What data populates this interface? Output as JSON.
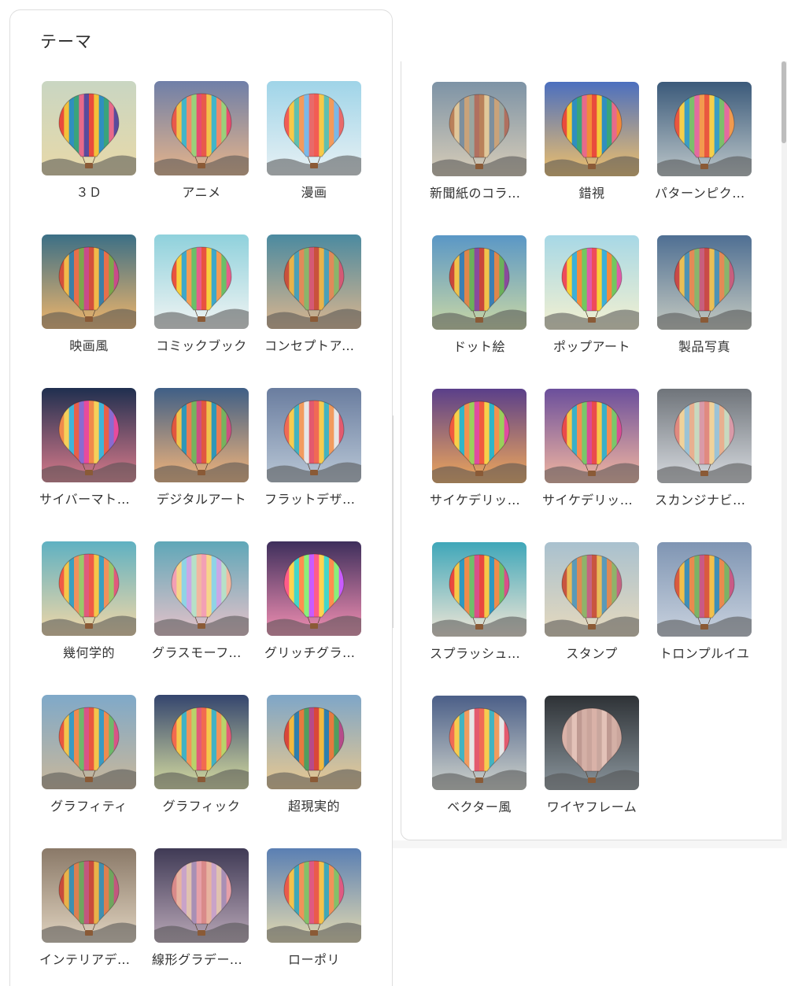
{
  "panel_title": "テーマ",
  "left_items": [
    {
      "label": "３Ｄ",
      "bg": [
        "#c9d6c2",
        "#e8d9a8"
      ],
      "stripes": [
        "#e94b3c",
        "#f3c13a",
        "#2f8fbf",
        "#3aa37b",
        "#e86a8a",
        "#5a4b9c"
      ]
    },
    {
      "label": "アニメ",
      "bg": [
        "#6f7fa8",
        "#e6b48a"
      ],
      "stripes": [
        "#e8594b",
        "#f2c14b",
        "#42b5c9",
        "#f08a6a",
        "#9ad07b",
        "#e84b6f"
      ]
    },
    {
      "label": "漫画",
      "bg": [
        "#9fd4e8",
        "#e8f1f4"
      ],
      "stripes": [
        "#f25c54",
        "#f7c948",
        "#5fbfb0",
        "#f49a5b",
        "#7ab8e8",
        "#e86a6a"
      ]
    },
    {
      "label": "映画風",
      "bg": [
        "#3b6f86",
        "#f0b56a"
      ],
      "stripes": [
        "#d4503b",
        "#f1b94a",
        "#3d7fa6",
        "#e86f4a",
        "#7da64b",
        "#c94b8a"
      ]
    },
    {
      "label": "コミックブック",
      "bg": [
        "#8fd1dc",
        "#f1f4f3"
      ],
      "stripes": [
        "#e9523f",
        "#f8cf3d",
        "#3da8c9",
        "#f39b55",
        "#6bbf68",
        "#e85c8a"
      ]
    },
    {
      "label": "コンセプトアート",
      "bg": [
        "#4b8aa0",
        "#d9b58e"
      ],
      "stripes": [
        "#c9513c",
        "#e7b34a",
        "#4aa0b8",
        "#e08a5a",
        "#8ab56b",
        "#d45a75"
      ]
    },
    {
      "label": "サイバーマトリックス",
      "bg": [
        "#1f2f4f",
        "#d97a8a"
      ],
      "stripes": [
        "#f08a4b",
        "#f5d05a",
        "#3fb5d9",
        "#e8604a",
        "#8a6bd0",
        "#e84b9c"
      ]
    },
    {
      "label": "デジタルアート",
      "bg": [
        "#3f5f86",
        "#f2b47a"
      ],
      "stripes": [
        "#e1573f",
        "#f0c24c",
        "#2f97b8",
        "#ea7c52",
        "#76b35e",
        "#cc4f82"
      ]
    },
    {
      "label": "フラットデザイン",
      "bg": [
        "#6a7d9f",
        "#b9c7d6"
      ],
      "stripes": [
        "#f06a55",
        "#f7cc4f",
        "#43b3c1",
        "#f29b5e",
        "#e6e6e6",
        "#e35a6e"
      ]
    },
    {
      "label": "幾何学的",
      "bg": [
        "#5fb1c2",
        "#f2d7a6"
      ],
      "stripes": [
        "#ef5a46",
        "#f5c64a",
        "#3a9fc0",
        "#f1905b",
        "#9ac86a",
        "#e05a7d"
      ]
    },
    {
      "label": "グラスモーフィズム",
      "bg": [
        "#5fa7b8",
        "#e6c2c9"
      ],
      "stripes": [
        "#f3a0b4",
        "#f6d58a",
        "#8fd3e6",
        "#c8a9e8",
        "#b6e0c8",
        "#f2b7a0"
      ]
    },
    {
      "label": "グリッチグラフィック",
      "bg": [
        "#3e2f5c",
        "#f28fb2"
      ],
      "stripes": [
        "#ff5c8a",
        "#ffd34f",
        "#44d6c9",
        "#ff8e4f",
        "#8af07a",
        "#c95cff"
      ]
    },
    {
      "label": "グラフィティ",
      "bg": [
        "#7fa9c9",
        "#c9b79a"
      ],
      "stripes": [
        "#e9573f",
        "#f3c44c",
        "#3a9ac2",
        "#ef8b4f",
        "#6fb86a",
        "#d95487"
      ]
    },
    {
      "label": "グラフィック",
      "bg": [
        "#34456e",
        "#d6dca0"
      ],
      "stripes": [
        "#f26a4f",
        "#f5c84b",
        "#41b2c4",
        "#f39459",
        "#b9d36a",
        "#e25b79"
      ]
    },
    {
      "label": "超現実的",
      "bg": [
        "#7ea6c8",
        "#e9c88f"
      ],
      "stripes": [
        "#d9473a",
        "#f1b93f",
        "#2e7fae",
        "#e57a3f",
        "#4f9e5f",
        "#b64b8a"
      ]
    },
    {
      "label": "インテリアデザイン",
      "bg": [
        "#8a7968",
        "#e0d3bf"
      ],
      "stripes": [
        "#c94b3b",
        "#e8b24a",
        "#3f8fb0",
        "#dd7f4f",
        "#6fa65e",
        "#c2577e"
      ]
    },
    {
      "label": "線形グラデーション",
      "bg": [
        "#3f3a55",
        "#b9a7b7"
      ],
      "stripes": [
        "#d98a8a",
        "#e7b3a0",
        "#c9a3c9",
        "#e0c2b0",
        "#a88fb5",
        "#e6a0a8"
      ]
    },
    {
      "label": "ローポリ",
      "bg": [
        "#5a7fb3",
        "#e2d9b0"
      ],
      "stripes": [
        "#ea5b4b",
        "#f4c24b",
        "#3fa8b9",
        "#f0925a",
        "#83c169",
        "#df5a82"
      ]
    }
  ],
  "right_items": [
    {
      "label": "新聞紙のコラージュ",
      "bg": [
        "#7d93a6",
        "#d8cdb8"
      ],
      "stripes": [
        "#b9805a",
        "#e0c79a",
        "#7d8f9e",
        "#c9a27a",
        "#9aa6a0",
        "#b07060"
      ]
    },
    {
      "label": "錯視",
      "bg": [
        "#4b6fbf",
        "#f0c06a"
      ],
      "stripes": [
        "#e94b3c",
        "#f5c93b",
        "#2f8fbf",
        "#3aa37b",
        "#e86a8a",
        "#f28a3a"
      ]
    },
    {
      "label": "パターンピクセル",
      "bg": [
        "#3b5a7a",
        "#bcc6c9"
      ],
      "stripes": [
        "#e9573f",
        "#f6cf4a",
        "#3b9ec4",
        "#7bbf6b",
        "#e36aa0",
        "#f29a4f"
      ]
    },
    {
      "label": "ドット絵",
      "bg": [
        "#5a97c6",
        "#c9d7a5"
      ],
      "stripes": [
        "#c9463b",
        "#f0c24b",
        "#3b7fb3",
        "#e0864a",
        "#6bb05a",
        "#8a4b9c"
      ]
    },
    {
      "label": "ポップアート",
      "bg": [
        "#a7d8e6",
        "#f3f0d0"
      ],
      "stripes": [
        "#ef4b5a",
        "#f7d23a",
        "#3bb0d9",
        "#f58a3f",
        "#73c75f",
        "#e05aa9"
      ]
    },
    {
      "label": "製品写真",
      "bg": [
        "#4f6f93",
        "#c4c9c0"
      ],
      "stripes": [
        "#c94a48",
        "#eabf55",
        "#4e93b5",
        "#e38a57",
        "#88b56d",
        "#c75f7e"
      ]
    },
    {
      "label": "サイケデリックアート",
      "bg": [
        "#5a3f8a",
        "#f0a85a"
      ],
      "stripes": [
        "#f05a3f",
        "#f7d04a",
        "#2fb5c9",
        "#f3904f",
        "#9ad05b",
        "#e04ba0"
      ]
    },
    {
      "label": "サイケデリックアート",
      "bg": [
        "#6b4f9c",
        "#f2b6a0"
      ],
      "stripes": [
        "#ea4b4b",
        "#f6c84a",
        "#3ab0c8",
        "#f58c52",
        "#7ac76a",
        "#d94b95"
      ]
    },
    {
      "label": "スカンジナビアンアート",
      "bg": [
        "#6f747a",
        "#d7dbe0"
      ],
      "stripes": [
        "#e08a80",
        "#f0d29a",
        "#9cc3d6",
        "#e8b090",
        "#c7d9c0",
        "#d99aa8"
      ]
    },
    {
      "label": "スプラッシュアート",
      "bg": [
        "#3fa7b9",
        "#f0e6d6"
      ],
      "stripes": [
        "#e9473f",
        "#f6c848",
        "#2f98c0",
        "#f08b4a",
        "#6fbf6a",
        "#d9508a"
      ]
    },
    {
      "label": "スタンプ",
      "bg": [
        "#a9c1cf",
        "#e6d9bd"
      ],
      "stripes": [
        "#c9553f",
        "#e8bb5a",
        "#5a9ab8",
        "#dd8a55",
        "#8fb36a",
        "#c46482"
      ]
    },
    {
      "label": "トロンプルイユ",
      "bg": [
        "#7f95b3",
        "#c9d2de"
      ],
      "stripes": [
        "#d95a3f",
        "#f2c04b",
        "#3e8fb8",
        "#e98a4f",
        "#7bb366",
        "#c95a86"
      ]
    },
    {
      "label": "ベクター風",
      "bg": [
        "#4b5f88",
        "#cfd3cc"
      ],
      "stripes": [
        "#f06a55",
        "#f7cc4f",
        "#43b3c1",
        "#f29b5e",
        "#e6e6e6",
        "#e35a6e"
      ]
    },
    {
      "label": "ワイヤフレーム",
      "bg": [
        "#2e3236",
        "#8a959c"
      ],
      "stripes": [
        "#d9b2a8",
        "#c9a79e",
        "#e3c2b8",
        "#bf9a92",
        "#d4b0a6",
        "#caa59c"
      ]
    }
  ]
}
